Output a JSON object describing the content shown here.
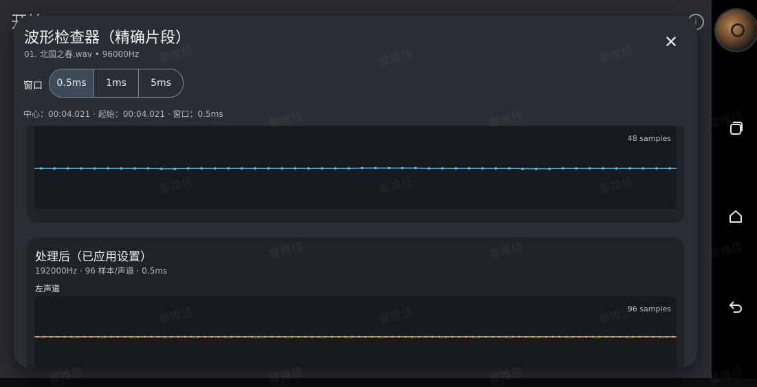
{
  "background": {
    "title": "开始",
    "info_icon": "info-icon"
  },
  "dialog": {
    "title": "波形检查器（精确片段）",
    "subtitle": "01. 北国之春.wav • 96000Hz",
    "close_icon": "close-icon",
    "window_label": "窗口",
    "window_options": [
      "0.5ms",
      "1ms",
      "5ms"
    ],
    "selected_window": "0.5ms",
    "info_line": "中心：00:04.021 · 起始：00:04.021 · 窗口：0.5ms"
  },
  "cards": [
    {
      "samples_label": "48 samples",
      "color": "#5fc3ee",
      "values": [
        0.0,
        0.0,
        0.0,
        0.0,
        0.0,
        0.0,
        0.0,
        0.0,
        0.0,
        -0.01,
        -0.01,
        0.0,
        0.0,
        0.0,
        0.0,
        0.0,
        0.0,
        0.0,
        0.0,
        0.0,
        0.0,
        0.0,
        0.0,
        0.0,
        0.01,
        0.01,
        0.01,
        0.01,
        0.01,
        0.0,
        0.0,
        0.0,
        0.0,
        0.0,
        0.0,
        0.0,
        -0.01,
        -0.01,
        -0.01,
        0.0,
        0.0,
        0.0,
        0.0,
        0.0,
        0.0,
        0.0,
        0.0,
        0.0
      ]
    },
    {
      "title": "处理后（已应用设置）",
      "subtitle": "192000Hz · 96 样本/声道 · 0.5ms",
      "channel": "左声道",
      "samples_label": "96 samples",
      "color": "#e6a860",
      "values": [
        0.0,
        0.0,
        0.0,
        0.0,
        0.0,
        0.0,
        0.0,
        0.0,
        0.0,
        0.0,
        0.0,
        0.0,
        0.0,
        0.0,
        0.0,
        0.0,
        0.0,
        0.0,
        0.0,
        0.0,
        0.0,
        0.0,
        0.0,
        0.0,
        0.0,
        0.0,
        0.0,
        0.0,
        0.0,
        0.0,
        0.0,
        0.0,
        0.0,
        0.0,
        0.0,
        0.0,
        0.0,
        0.0,
        0.0,
        0.0,
        0.0,
        0.0,
        0.0,
        0.0,
        0.0,
        0.0,
        0.0,
        0.0,
        0.0,
        0.0,
        0.0,
        0.0,
        0.0,
        0.0,
        0.0,
        0.0,
        0.0,
        0.0,
        0.0,
        0.0,
        0.0,
        0.0,
        0.0,
        0.0,
        0.0,
        0.0,
        0.0,
        0.0,
        0.0,
        0.0,
        0.0,
        0.0,
        0.0,
        0.0,
        0.0,
        0.0,
        0.0,
        0.0,
        0.0,
        0.0,
        0.0,
        0.0,
        0.0,
        0.0,
        0.0,
        0.0,
        0.0,
        0.0,
        0.0,
        0.0,
        0.0,
        0.0,
        0.0,
        0.0,
        0.0,
        0.0
      ]
    }
  ],
  "nav": {
    "recents_icon": "recents-icon",
    "home_icon": "home-icon",
    "back_icon": "back-icon"
  },
  "watermark": "瞿帷佳"
}
